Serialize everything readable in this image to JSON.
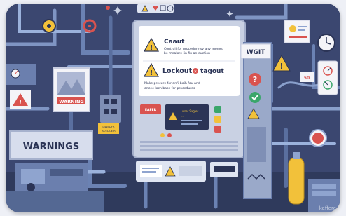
{
  "colors": {
    "background": "#394568",
    "pipe": "#5b6f9a",
    "pipe_light": "#8fa4cf",
    "panel": "#c9d1e3",
    "warning_yellow": "#f2c13a",
    "danger_red": "#d9534f",
    "accent_green": "#3aa66a"
  },
  "top_icons": [
    "warning-diamond-icon",
    "heart-icon",
    "plus-box-icon",
    "gauge-icon"
  ],
  "main_panel": {
    "caution_title": "Caaut",
    "caution_text_1": "Controll for procedure sy any mones",
    "caution_text_2": "be mealore iin fin an duction",
    "lockout_title": "Lockout",
    "tagout_title": "tagout",
    "lockout_text_1": "Make precure for arr'i boih fou and",
    "lockout_text_2": "oncee locn base for procedures",
    "red_label": "EAFER",
    "screen_line_1": "Lwrer Sxgler",
    "screen_line_2": "..."
  },
  "left_sign": {
    "label": "WARNING"
  },
  "warnings_box": {
    "label": "WARNINGS"
  },
  "small_tag": {
    "line_1": "LIWEDFR",
    "line_2": "AUEDCEIR"
  },
  "right_sign": {
    "label": "WGIT"
  },
  "right_small_label": "50",
  "watermark": "keffere"
}
